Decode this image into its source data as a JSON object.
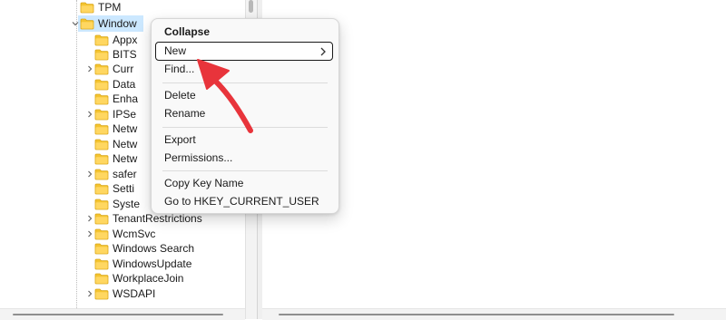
{
  "tree": {
    "nodes": [
      {
        "label": "TPM",
        "expander": "none"
      },
      {
        "label": "Window",
        "expander": "expanded",
        "selected": true
      },
      {
        "label": "Appx",
        "expander": "none"
      },
      {
        "label": "BITS",
        "expander": "none"
      },
      {
        "label": "Curr",
        "expander": "collapsed"
      },
      {
        "label": "Data",
        "expander": "none"
      },
      {
        "label": "Enha",
        "expander": "none"
      },
      {
        "label": "IPSe",
        "expander": "collapsed"
      },
      {
        "label": "Netw",
        "expander": "none"
      },
      {
        "label": "Netw",
        "expander": "none"
      },
      {
        "label": "Netw",
        "expander": "none"
      },
      {
        "label": "safer",
        "expander": "collapsed"
      },
      {
        "label": "Setti",
        "expander": "none"
      },
      {
        "label": "Syste",
        "expander": "none"
      },
      {
        "label": "TenantRestrictions",
        "expander": "collapsed"
      },
      {
        "label": "WcmSvc",
        "expander": "collapsed"
      },
      {
        "label": "Windows Search",
        "expander": "none"
      },
      {
        "label": "WindowsUpdate",
        "expander": "none"
      },
      {
        "label": "WorkplaceJoin",
        "expander": "none"
      },
      {
        "label": "WSDAPI",
        "expander": "collapsed"
      }
    ]
  },
  "context_menu": {
    "collapse": "Collapse",
    "new": "New",
    "find": "Find...",
    "delete": "Delete",
    "rename": "Rename",
    "export": "Export",
    "permissions": "Permissions...",
    "copy_key_name": "Copy Key Name",
    "goto_hkcu": "Go to HKEY_CURRENT_USER"
  },
  "colors": {
    "folder": "#f4c430",
    "selection": "#cce8ff",
    "annotation_arrow": "#e8343b"
  }
}
